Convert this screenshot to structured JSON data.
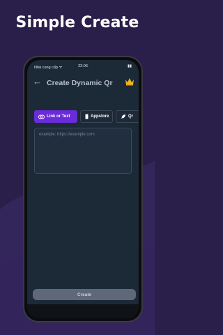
{
  "headline": "Simple Create",
  "status_bar": {
    "carrier": "Nhà cung cấp ᯤ",
    "time": "22:06",
    "right": "▮▮"
  },
  "header": {
    "title": "Create Dynamic Qr",
    "back_icon": "arrow-left-icon",
    "premium_icon": "crown-icon"
  },
  "tabs": [
    {
      "label": "Link or Text",
      "icon": "link-icon",
      "active": true
    },
    {
      "label": "Appstore",
      "icon": "phone-icon",
      "active": false
    },
    {
      "label": "Qr",
      "icon": "rocket-icon",
      "active": false
    }
  ],
  "input": {
    "placeholder": "example: https://example.com",
    "value": ""
  },
  "create_button": {
    "label": "Create"
  },
  "colors": {
    "background": "#2a1f4a",
    "screen": "#1c2937",
    "active_tab": "#6a2bd8",
    "button": "#5e6878",
    "crown": "#f2b51c"
  }
}
